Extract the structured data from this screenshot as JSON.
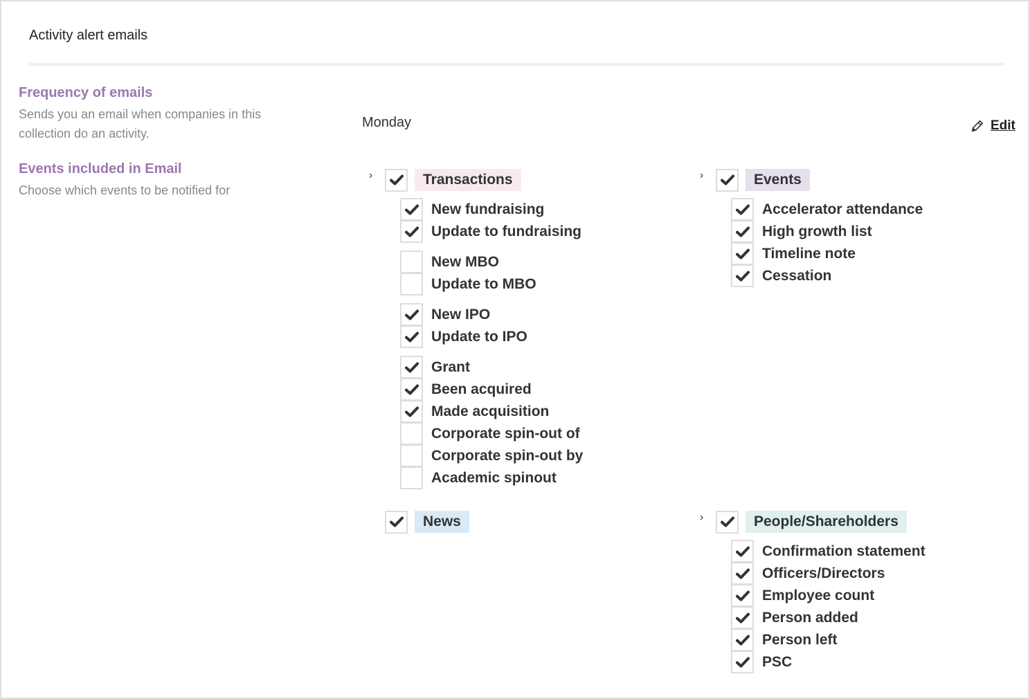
{
  "header": {
    "title": "Activity alert emails"
  },
  "frequency": {
    "heading": "Frequency of emails",
    "description": "Sends you an email when companies in this collection do an activity.",
    "value": "Monday",
    "edit_label": "Edit"
  },
  "events_section": {
    "heading": "Events included in Email",
    "description": "Choose which events to be notified for"
  },
  "colors": {
    "accent_purple": "#9b77b1",
    "transactions_tag": "#f8e9ee",
    "events_tag": "#e6dfec",
    "news_tag": "#d9e9f5",
    "people_tag": "#dff0ee"
  },
  "groups": {
    "transactions": {
      "label": "Transactions",
      "checked": true,
      "expandable": true,
      "items": [
        {
          "label": "New fundraising",
          "checked": true
        },
        {
          "label": "Update to fundraising",
          "checked": true
        },
        {
          "label": "New MBO",
          "checked": false
        },
        {
          "label": "Update to MBO",
          "checked": false
        },
        {
          "label": "New IPO",
          "checked": true
        },
        {
          "label": "Update to IPO",
          "checked": true
        },
        {
          "label": "Grant",
          "checked": true
        },
        {
          "label": "Been acquired",
          "checked": true
        },
        {
          "label": "Made acquisition",
          "checked": true
        },
        {
          "label": "Corporate spin-out of",
          "checked": false
        },
        {
          "label": "Corporate spin-out by",
          "checked": false
        },
        {
          "label": "Academic spinout",
          "checked": false
        }
      ]
    },
    "events": {
      "label": "Events",
      "checked": true,
      "expandable": true,
      "items": [
        {
          "label": "Accelerator attendance",
          "checked": true
        },
        {
          "label": "High growth list",
          "checked": true
        },
        {
          "label": "Timeline note",
          "checked": true
        },
        {
          "label": "Cessation",
          "checked": true
        }
      ]
    },
    "news": {
      "label": "News",
      "checked": true,
      "expandable": false,
      "items": []
    },
    "people": {
      "label": "People/Shareholders",
      "checked": true,
      "expandable": true,
      "items": [
        {
          "label": "Confirmation statement",
          "checked": true
        },
        {
          "label": "Officers/Directors",
          "checked": true
        },
        {
          "label": "Employee count",
          "checked": true
        },
        {
          "label": "Person added",
          "checked": true
        },
        {
          "label": "Person left",
          "checked": true
        },
        {
          "label": "PSC",
          "checked": true
        }
      ]
    }
  }
}
